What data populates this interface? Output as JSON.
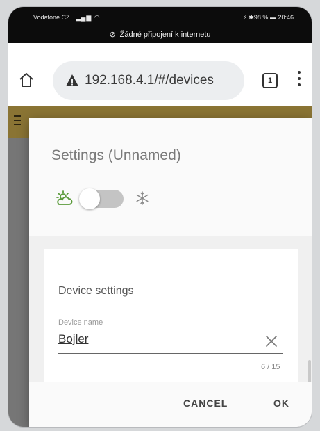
{
  "status_bar": {
    "carrier": "Vodafone CZ",
    "right": "⚡ ✱98 %",
    "time": "20:46"
  },
  "notice": {
    "text": "Žádné připojení k internetu"
  },
  "browser": {
    "url": "192.168.4.1/#/devices",
    "tab_count": "1"
  },
  "dialog": {
    "title": "Settings (Unnamed)",
    "section_title": "Device settings",
    "field_label": "Device name",
    "field_value": "Bojler",
    "char_count": "6 / 15",
    "cancel_label": "CANCEL",
    "ok_label": "OK"
  },
  "colors": {
    "header_band": "#8a7434",
    "sun_icon": "#5a9a3a",
    "toggle_track": "#c4c4c4"
  }
}
